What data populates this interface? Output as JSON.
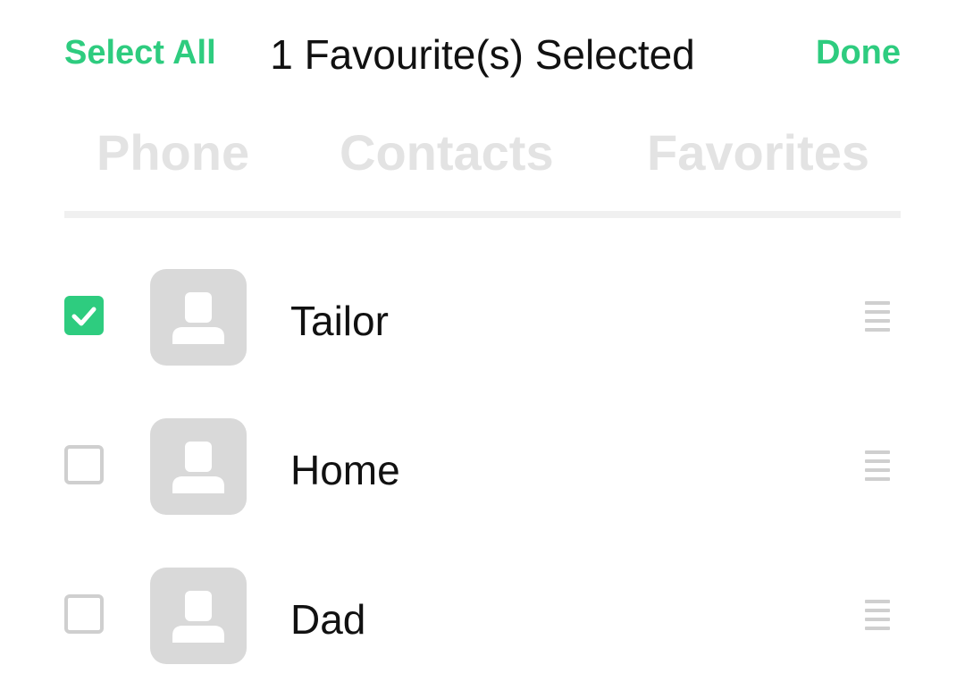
{
  "header": {
    "select_all_label": "Select All",
    "title": "1 Favourite(s) Selected",
    "done_label": "Done"
  },
  "tabs": [
    {
      "label": "Phone"
    },
    {
      "label": "Contacts"
    },
    {
      "label": "Favorites"
    }
  ],
  "favourites": [
    {
      "name": "Tailor",
      "checked": true
    },
    {
      "name": "Home",
      "checked": false
    },
    {
      "name": "Dad",
      "checked": false
    }
  ],
  "colors": {
    "accent": "#2ecc7f",
    "tab_inactive": "#e3e3e3",
    "avatar_bg": "#d9d9d9",
    "checkbox_border": "#cfcfcf"
  },
  "icons": {
    "avatar": "person-placeholder-icon",
    "drag": "drag-handle-icon",
    "check": "checkmark-icon"
  }
}
